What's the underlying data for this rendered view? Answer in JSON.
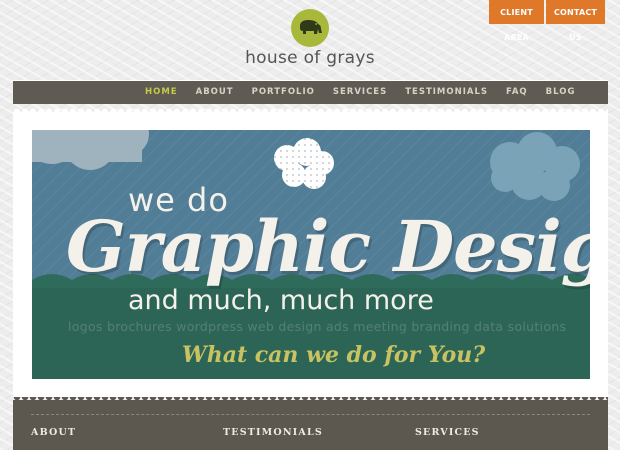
{
  "header": {
    "client_area_label": "CLIENT AREA",
    "contact_label": "CONTACT US",
    "brand_name": "house of grays",
    "logo_icon": "elephant-icon"
  },
  "nav": {
    "items": [
      {
        "label": "HOME",
        "active": true
      },
      {
        "label": "ABOUT",
        "active": false
      },
      {
        "label": "PORTFOLIO",
        "active": false
      },
      {
        "label": "SERVICES",
        "active": false
      },
      {
        "label": "TESTIMONIALS",
        "active": false
      },
      {
        "label": "FAQ",
        "active": false
      },
      {
        "label": "BLOG",
        "active": false
      }
    ]
  },
  "banner": {
    "line1": "we do",
    "headline": "Graphic Design",
    "line2": "and much, much more",
    "services_line": "logos  brochures  wordpress  web design  ads  meeting branding  data solutions",
    "cta": "What can we do for You?"
  },
  "footer": {
    "col1_title": "ABOUT",
    "col2_title": "TESTIMONIALS",
    "col3_title": "SERVICES"
  },
  "colors": {
    "orange_button": "#e0782a",
    "logo_green": "#a8b83a",
    "nav_bg": "#5f5a52",
    "nav_active": "#c3cb49",
    "banner_sky": "#527d96",
    "banner_ground": "#2f6b5a",
    "footer_bg": "#5c574f"
  }
}
